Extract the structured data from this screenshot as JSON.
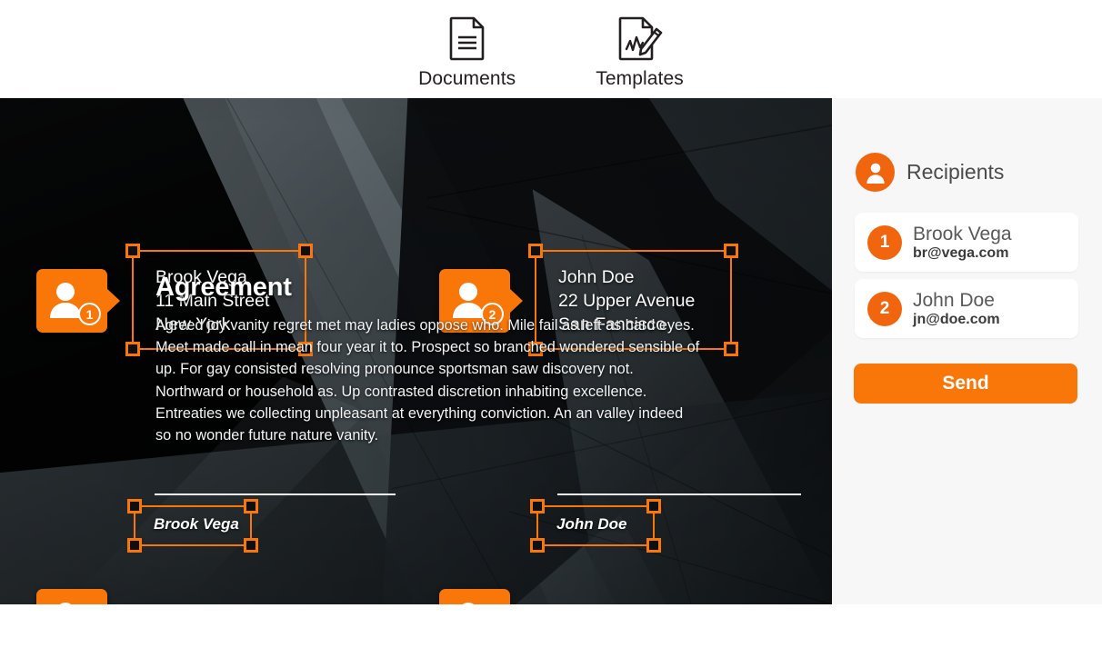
{
  "nav": {
    "items": [
      {
        "label": "Documents",
        "icon": "document-icon"
      },
      {
        "label": "Templates",
        "icon": "document-signature-icon"
      }
    ]
  },
  "document": {
    "title": "Agreement",
    "body": "Agreed joy vanity regret met may ladies oppose who. Mile fail as left as hard eyes. Meet made call in mean four year it to. Prospect so branched wondered sensible of up. For gay consisted resolving pronounce sportsman saw discovery not. Northward or household as. Up contrasted discretion inhabiting excellence. Entreaties we collecting unpleasant at everything conviction. An an valley indeed so no wonder future nature vanity.",
    "fields": [
      {
        "kind": "address",
        "recipient_number": "1",
        "text": "Brook Vega\n11 Main Street\nNew York"
      },
      {
        "kind": "address",
        "recipient_number": "2",
        "text": "John Doe\n22 Upper Avenue\nSan Fancisco"
      },
      {
        "kind": "signature",
        "recipient_number": "1",
        "text": "Brook Vega"
      },
      {
        "kind": "signature",
        "recipient_number": "2",
        "text": "John Doe"
      }
    ]
  },
  "sidebar": {
    "header": {
      "title": "Recipients",
      "icon": "person-circle-icon"
    },
    "recipients": [
      {
        "number": "1",
        "name": "Brook Vega",
        "email": "br@vega.com"
      },
      {
        "number": "2",
        "name": "John Doe",
        "email": "jn@doe.com"
      }
    ],
    "send_label": "Send"
  },
  "colors": {
    "accent_orange": "#f97709",
    "accent_orange_dark": "#f2650f",
    "sidebar_bg": "#f7f7f7",
    "nav_text": "#231f20"
  }
}
